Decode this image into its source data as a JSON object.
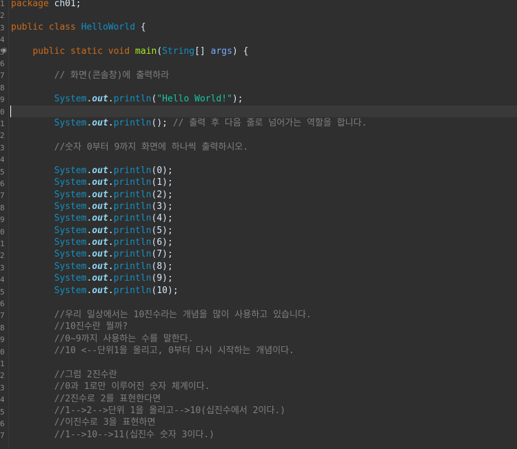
{
  "editor": {
    "gutter_numbers": [
      "1",
      "2",
      "3",
      "4",
      "5",
      "6",
      "7",
      "8",
      "9",
      "0",
      "1",
      "2",
      "3",
      "4",
      "5",
      "6",
      "7",
      "8",
      "9",
      "0",
      "1",
      "2",
      "3",
      "4",
      "5",
      "6",
      "7",
      "8",
      "9",
      "0",
      "1",
      "2",
      "3",
      "4",
      "5",
      "6",
      "7"
    ],
    "lines": {
      "package_kw": "package",
      "package_name": " ch01;",
      "public_kw": "public",
      "class_kw": "class",
      "class_name": "HelloWorld",
      "open_brace": " {",
      "main_public": "public",
      "main_static": "static",
      "main_void": "void",
      "main_name": "main",
      "main_open": "(",
      "main_string": "String",
      "main_arr": "[] ",
      "main_args": "args",
      "main_close": ") {",
      "comment_console": "// 화면(콘솔창)에 출력하라",
      "system": "System",
      "dot": ".",
      "out": "out",
      "println": "println",
      "hello_open": "(",
      "hello_str": "\"Hello World!\"",
      "hello_close": ");",
      "empty_call": "();",
      "comment_newline": " // 출력 후 다음 줄로 넘어가는 역할을 합니다.",
      "comment_numbers": "//숫자 0부터 9까지 화면에 하나씩 출력하시오.",
      "println_args": [
        "(0);",
        "(1);",
        "(2);",
        "(3);",
        "(4);",
        "(5);",
        "(6);",
        "(7);",
        "(8);",
        "(9);",
        "(10);"
      ],
      "comment_block1": [
        "//우리 일상에서는 10진수라는 개념을 많이 사용하고 있습니다.",
        "//10진수란 뭘까?",
        "//0~9까지 사용하는 수를 말한다.",
        "//10 <--단위1을 올리고, 0부터 다시 시작하는 개념이다."
      ],
      "comment_block2": [
        "//그럼 2진수란",
        "//0과 1로만 이루어진 숫자 체계이다.",
        "//2진수로 2를 표현한다면",
        "//1-->2-->단위 1을 올리고-->10(십진수에서 2이다.)",
        "//이진수로 3을 표현하면",
        "//1-->10-->11(십진수 숫자 3이다.)"
      ]
    }
  },
  "colors": {
    "background": "#2f2f2f",
    "keyword": "#cc6c1d",
    "class": "#1290c3",
    "method": "#a7ec21",
    "string": "#17c6a3",
    "comment": "#808080",
    "field": "#8dd8f8"
  },
  "icons": {
    "fold": "fold-minus-icon"
  }
}
